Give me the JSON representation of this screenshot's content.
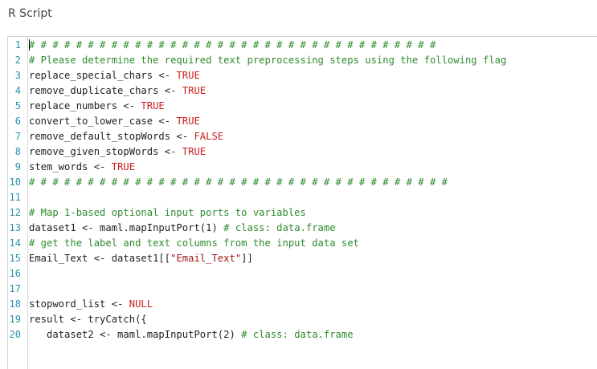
{
  "window": {
    "title": "R Script"
  },
  "editor": {
    "lines": [
      {
        "n": "1",
        "tokens": [
          {
            "t": "# # # # # # # # # # # # # # # # # # # # # # # # # # # # # # # # # # #",
            "c": "comment"
          }
        ]
      },
      {
        "n": "2",
        "tokens": [
          {
            "t": "# Please determine the required text preprocessing steps using the following flag",
            "c": "comment"
          }
        ]
      },
      {
        "n": "3",
        "tokens": [
          {
            "t": "replace_special_chars <- ",
            "c": "plain"
          },
          {
            "t": "TRUE",
            "c": "bool"
          }
        ]
      },
      {
        "n": "4",
        "tokens": [
          {
            "t": "remove_duplicate_chars <- ",
            "c": "plain"
          },
          {
            "t": "TRUE",
            "c": "bool"
          }
        ]
      },
      {
        "n": "5",
        "tokens": [
          {
            "t": "replace_numbers <- ",
            "c": "plain"
          },
          {
            "t": "TRUE",
            "c": "bool"
          }
        ]
      },
      {
        "n": "6",
        "tokens": [
          {
            "t": "convert_to_lower_case <- ",
            "c": "plain"
          },
          {
            "t": "TRUE",
            "c": "bool"
          }
        ]
      },
      {
        "n": "7",
        "tokens": [
          {
            "t": "remove_default_stopWords <- ",
            "c": "plain"
          },
          {
            "t": "FALSE",
            "c": "bool"
          }
        ]
      },
      {
        "n": "8",
        "tokens": [
          {
            "t": "remove_given_stopWords <- ",
            "c": "plain"
          },
          {
            "t": "TRUE",
            "c": "bool"
          }
        ]
      },
      {
        "n": "9",
        "tokens": [
          {
            "t": "stem_words <- ",
            "c": "plain"
          },
          {
            "t": "TRUE",
            "c": "bool"
          }
        ]
      },
      {
        "n": "10",
        "tokens": [
          {
            "t": "# # # # # # # # # # # # # # # # # # # # # # # # # # # # # # # # # # # #",
            "c": "comment"
          }
        ]
      },
      {
        "n": "11",
        "tokens": []
      },
      {
        "n": "12",
        "tokens": [
          {
            "t": "# Map 1-based optional input ports to variables",
            "c": "comment"
          }
        ]
      },
      {
        "n": "13",
        "tokens": [
          {
            "t": "dataset1 <- maml.mapInputPort(1) ",
            "c": "plain"
          },
          {
            "t": "# class: data.frame",
            "c": "comment"
          }
        ]
      },
      {
        "n": "14",
        "tokens": [
          {
            "t": "# get the label and text columns from the input data set",
            "c": "comment"
          }
        ]
      },
      {
        "n": "15",
        "tokens": [
          {
            "t": "Email_Text <- dataset1[[",
            "c": "plain"
          },
          {
            "t": "\"Email_Text\"",
            "c": "string"
          },
          {
            "t": "]]",
            "c": "plain"
          }
        ]
      },
      {
        "n": "16",
        "tokens": []
      },
      {
        "n": "17",
        "tokens": []
      },
      {
        "n": "18",
        "tokens": [
          {
            "t": "stopword_list <- ",
            "c": "plain"
          },
          {
            "t": "NULL",
            "c": "null"
          }
        ]
      },
      {
        "n": "19",
        "tokens": [
          {
            "t": "result <- tryCatch({",
            "c": "plain"
          }
        ]
      },
      {
        "n": "20",
        "tokens": [
          {
            "t": "   dataset2 <- maml.mapInputPort(2) ",
            "c": "plain"
          },
          {
            "t": "# class: data.frame",
            "c": "comment"
          }
        ]
      }
    ]
  },
  "colors": {
    "comment": "#2e8b2e",
    "keyword_literal": "#c81e1e",
    "string": "#a31515",
    "line_number": "#2b91af"
  }
}
